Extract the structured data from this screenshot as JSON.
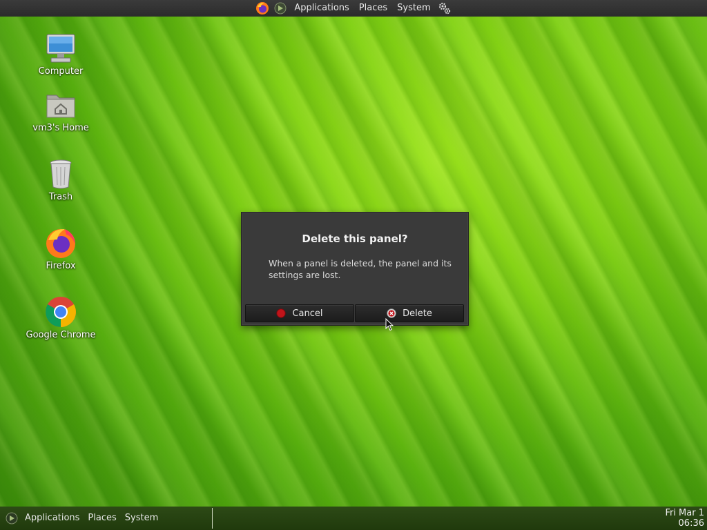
{
  "top_panel": {
    "menu": [
      "Applications",
      "Places",
      "System"
    ],
    "icons": [
      "firefox-icon",
      "gnome-foot-icon",
      "settings-gear-icon"
    ]
  },
  "bottom_panel": {
    "menu": [
      "Applications",
      "Places",
      "System"
    ],
    "clock": {
      "date": "Fri Mar 1",
      "time": "06:36"
    }
  },
  "desktop_icons": [
    {
      "label": "Computer",
      "icon": "computer-icon"
    },
    {
      "label": "vm3's Home",
      "icon": "home-folder-icon"
    },
    {
      "label": "Trash",
      "icon": "trash-icon"
    },
    {
      "label": "Firefox",
      "icon": "firefox-icon"
    },
    {
      "label": "Google Chrome",
      "icon": "chrome-icon"
    }
  ],
  "dialog": {
    "title": "Delete this panel?",
    "message": "When a panel is deleted, the panel and its settings are lost.",
    "cancel_label": "Cancel",
    "delete_label": "Delete"
  },
  "colors": {
    "panel_bg": "#2b2b2b",
    "dialog_bg": "#3a3a3a",
    "wallpaper_green": "#7fcf12",
    "button_red": "#c0141a"
  }
}
